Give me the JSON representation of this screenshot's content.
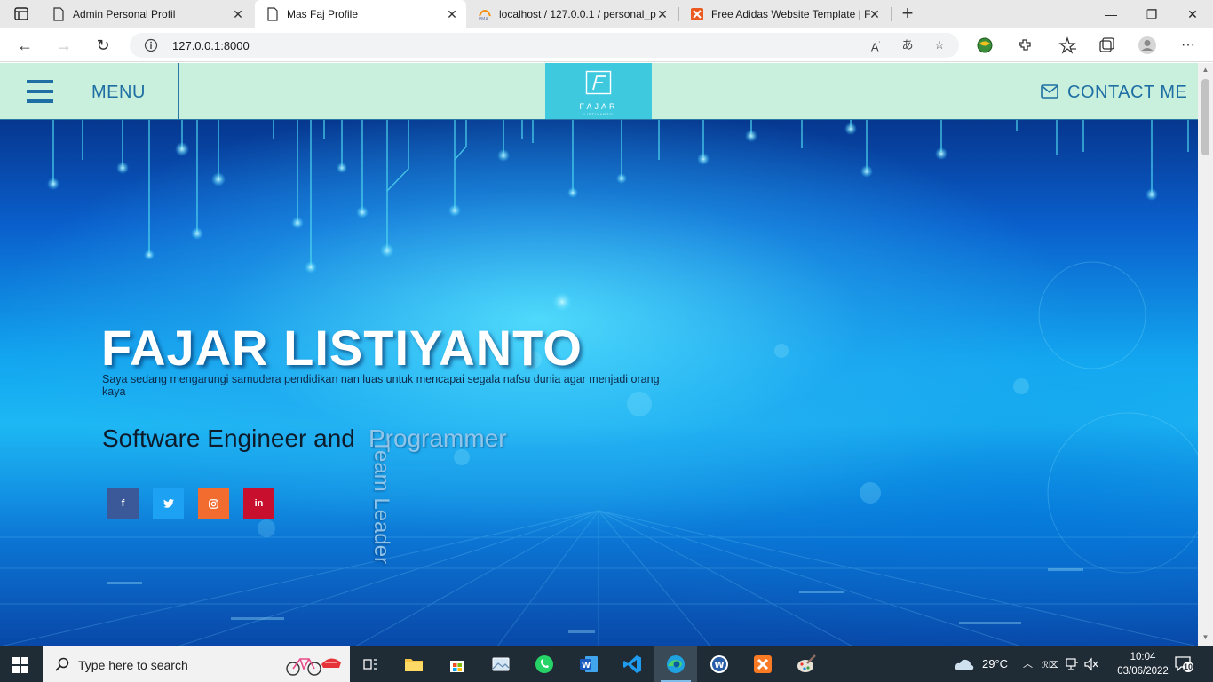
{
  "browser": {
    "tabs": [
      {
        "title": "Admin Personal Profil",
        "active": false
      },
      {
        "title": "Mas Faj Profile",
        "active": true
      },
      {
        "title": "localhost / 127.0.0.1 / personal_p",
        "active": false
      },
      {
        "title": "Free Adidas Website Template | F",
        "active": false
      }
    ],
    "url": "127.0.0.1:8000"
  },
  "site": {
    "menu_label": "MENU",
    "logo_text": "FAJAR",
    "logo_subtext": "LISTIYANTO",
    "contact_label": "CONTACT ME"
  },
  "hero": {
    "name": "FAJAR LISTIYANTO",
    "tagline": "Saya sedang mengarungi samudera pendidikan nan luas untuk mencapai segala nafsu dunia agar menjadi orang kaya",
    "role_prefix": "Software Engineer and",
    "role_rotating": "Programmer",
    "role_vertical": "Team Leader",
    "social": [
      {
        "label": "f",
        "name": "facebook",
        "color": "#3b5998"
      },
      {
        "label": "t",
        "name": "twitter",
        "color": "#1da1f2"
      },
      {
        "label": "ig",
        "name": "instagram",
        "color": "#f26b2f"
      },
      {
        "label": "in",
        "name": "linkedin",
        "color": "#c8102e"
      }
    ]
  },
  "taskbar": {
    "search_placeholder": "Type here to search",
    "temperature": "29°C",
    "time": "10:04",
    "date": "03/06/2022",
    "notification_count": "10"
  }
}
